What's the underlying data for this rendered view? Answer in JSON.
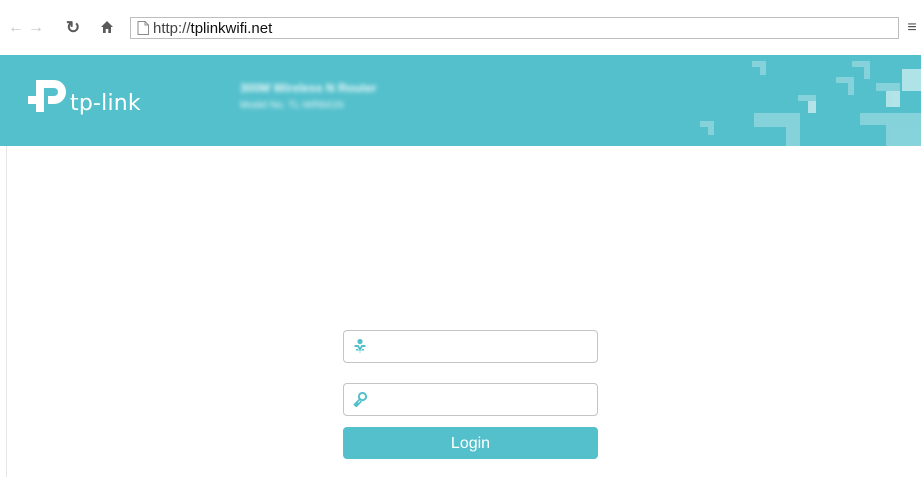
{
  "browser": {
    "back_icon": "arrow-left-icon",
    "forward_icon": "arrow-right-icon",
    "reload_icon": "reload-icon",
    "home_icon": "home-icon",
    "page_icon": "page-icon",
    "menu_icon": "hamburger-menu-icon",
    "url_scheme": "http://",
    "url_host": "tplinkwifi.net"
  },
  "header": {
    "brand": "tp-link",
    "product_name": "300M Wireless N Router",
    "model_number": "Model No. TL-WR841N",
    "background_color": "#54c0cc"
  },
  "login": {
    "username_icon": "user-icon",
    "username_value": "",
    "password_icon": "key-icon",
    "password_value": "",
    "button_label": "Login",
    "accent_color": "#54c0cc"
  }
}
